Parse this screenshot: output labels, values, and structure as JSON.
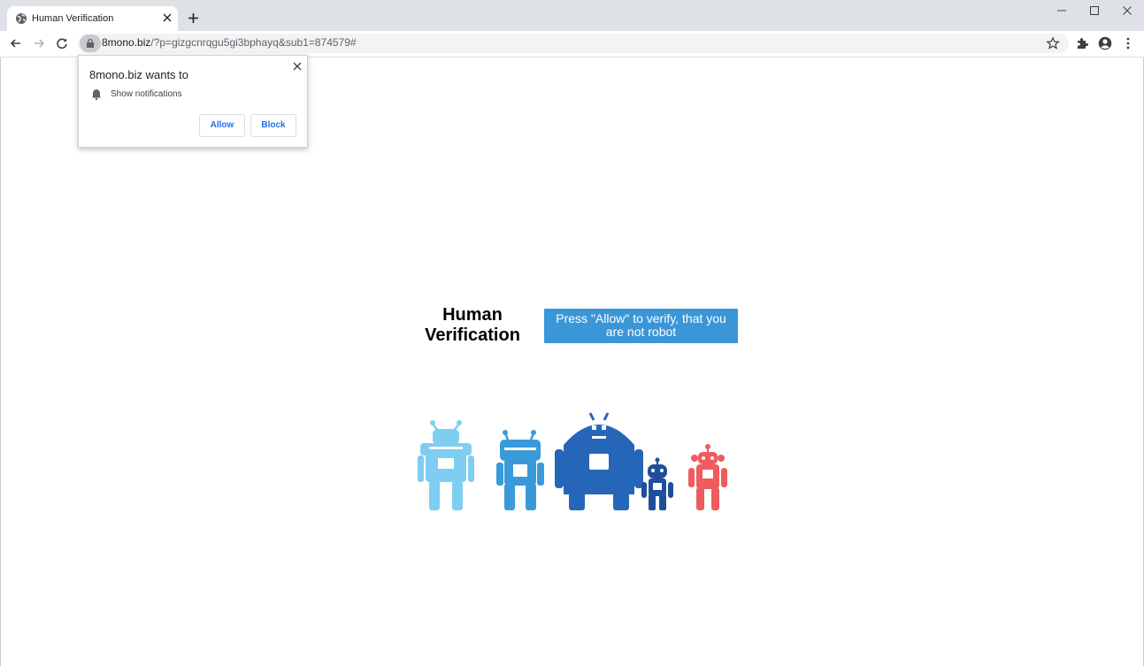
{
  "browser": {
    "tab_title": "Human Verification",
    "url_host": "8mono.biz",
    "url_path": "/?p=gizgcnrqgu5gi3bphayq&sub1=874579#"
  },
  "permission_prompt": {
    "title": "8mono.biz wants to",
    "permission_label": "Show notifications",
    "allow_label": "Allow",
    "block_label": "Block"
  },
  "page": {
    "headline_line1": "Human",
    "headline_line2": "Verification",
    "verify_button_label": "Press \"Allow\" to verify, that you are not robot",
    "robot_colors": [
      "#7fcdf0",
      "#3a9ad9",
      "#2566b8",
      "#1f4f9c",
      "#ef5b5e"
    ]
  },
  "icons": {
    "tab_favicon": "globe-icon",
    "back": "arrow-left-icon",
    "forward": "arrow-right-icon",
    "reload": "reload-icon",
    "lock": "lock-icon",
    "bookmark": "star-icon",
    "extensions": "puzzle-icon",
    "profile": "account-icon",
    "menu": "kebab-menu-icon",
    "notification": "bell-icon"
  }
}
